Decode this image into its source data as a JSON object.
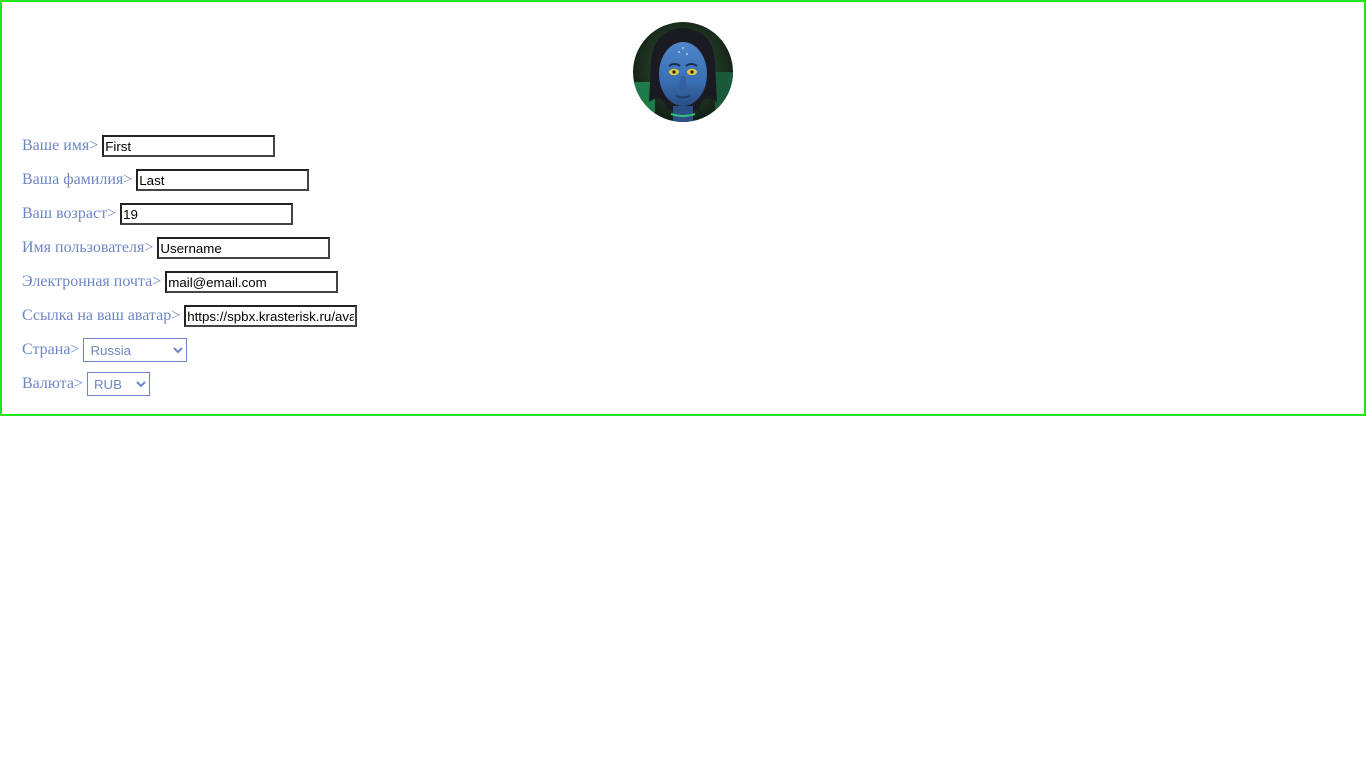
{
  "profile": {
    "avatar_icon": "avatar-photo-blue-face",
    "fields": {
      "firstname": {
        "label": "Ваше имя>",
        "value": "First"
      },
      "lastname": {
        "label": "Ваша фамилия>",
        "value": "Last"
      },
      "age": {
        "label": "Ваш возраст>",
        "value": "19"
      },
      "username": {
        "label": "Имя пользователя>",
        "value": "Username"
      },
      "email": {
        "label": "Электронная почта>",
        "value": "mail@email.com"
      },
      "avatar_url": {
        "label": "Ссылка на ваш аватар>",
        "value": "https://spbx.krasterisk.ru/ava"
      },
      "country": {
        "label": "Страна>",
        "selected": "Russia"
      },
      "currency": {
        "label": "Валюта>",
        "selected": "RUB"
      }
    }
  },
  "colors": {
    "border": "#1fe61f",
    "label": "#6d86c4"
  }
}
